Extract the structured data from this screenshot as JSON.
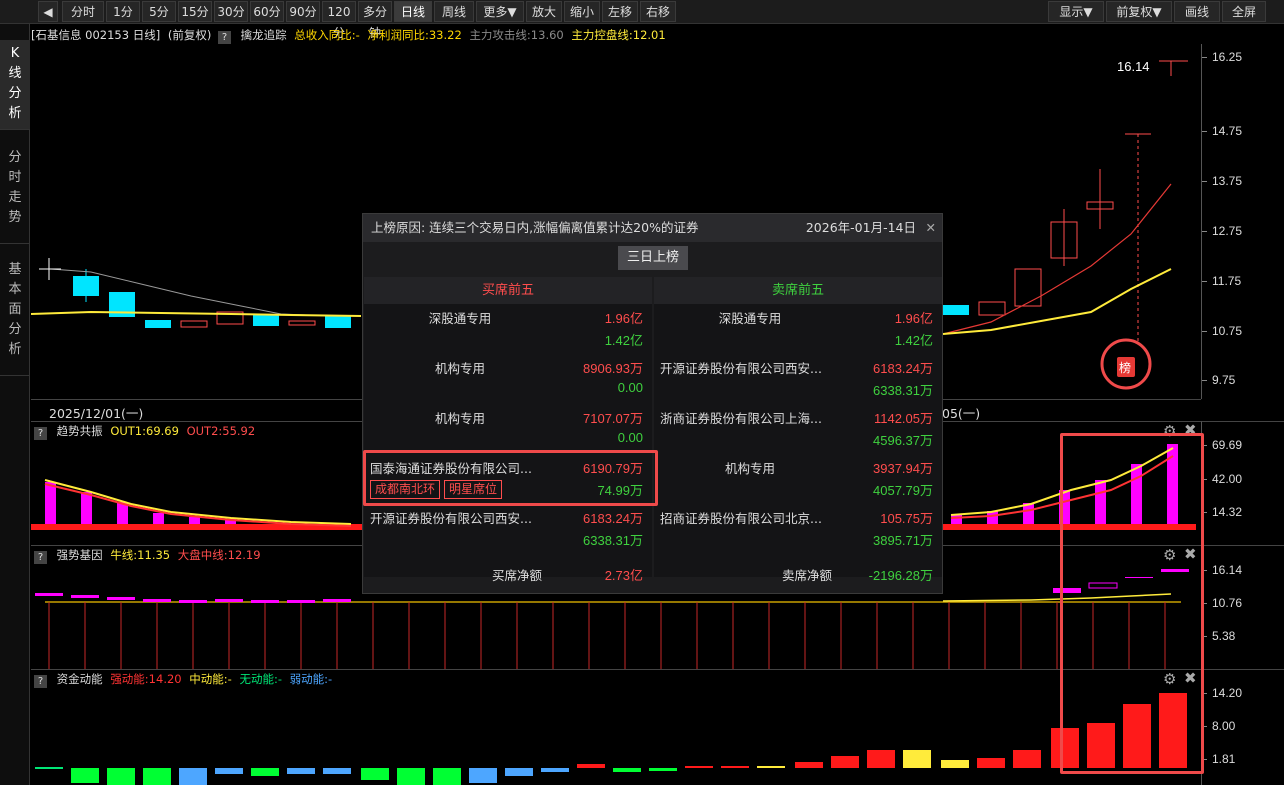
{
  "toolbar": {
    "items": [
      "分时",
      "1分",
      "5分",
      "15分",
      "30分",
      "60分",
      "90分",
      "120分",
      "多分钟",
      "日线",
      "周线",
      "更多▼",
      "放大",
      "缩小",
      "左移",
      "右移"
    ],
    "right": [
      "显示▼",
      "前复权▼",
      "画线",
      "全屏"
    ],
    "active": "日线"
  },
  "sidebar": {
    "tabs": [
      "K线分析",
      "分时走势",
      "基本面分析"
    ]
  },
  "info": {
    "stock": "[石基信息 002153 日线]",
    "adj": "(前复权)",
    "tool": "擒龙追踪",
    "revenue": "总收入同比:-",
    "profit": "净利润同比:33.22",
    "attack": "主力攻击线:13.60",
    "control": "主力控盘线:12.01"
  },
  "price_axis": {
    "ticks": [
      "16.25",
      "14.75",
      "13.75",
      "12.75",
      "11.75",
      "10.75",
      "9.75"
    ]
  },
  "price_chart": {
    "last_price": "16.14",
    "badge": "榜",
    "date_left": "2025/12/01(一)",
    "date_right": "05(一)"
  },
  "panel1": {
    "name": "趋势共振",
    "out1": "OUT1:69.69",
    "out2": "OUT2:55.92",
    "ticks": [
      "69.69",
      "42.00",
      "14.32"
    ]
  },
  "panel2": {
    "name": "强势基因",
    "bull": "牛线:11.35",
    "market": "大盘中线:12.19",
    "ticks": [
      "16.14",
      "10.76",
      "5.38"
    ]
  },
  "panel3": {
    "name": "资金动能",
    "strong": "强动能:14.20",
    "mid": "中动能:-",
    "none": "无动能:-",
    "weak": "弱动能:-",
    "ticks": [
      "14.20",
      "8.00",
      "1.81"
    ]
  },
  "popup": {
    "reason": "上榜原因: 连续三个交易日内,涨幅偏离值累计达20%的证券",
    "date": "2026年-01月-14日",
    "button": "三日上榜",
    "buy_title": "买席前五",
    "sell_title": "卖席前五",
    "buy_rows": [
      {
        "name": "深股通专用",
        "v1": "1.96亿",
        "v2": "1.42亿"
      },
      {
        "name": "机构专用",
        "v1": "8906.93万",
        "v2": "0.00"
      },
      {
        "name": "机构专用",
        "v1": "7107.07万",
        "v2": "0.00"
      },
      {
        "name": "国泰海通证券股份有限公司...",
        "v1": "6190.79万",
        "v2": "74.99万",
        "tag1": "成都南北环",
        "tag2": "明星席位"
      },
      {
        "name": "开源证券股份有限公司西安...",
        "v1": "6183.24万",
        "v2": "6338.31万"
      }
    ],
    "sell_rows": [
      {
        "name": "深股通专用",
        "v1": "1.96亿",
        "v2": "1.42亿"
      },
      {
        "name": "开源证券股份有限公司西安...",
        "v1": "6183.24万",
        "v2": "6338.31万"
      },
      {
        "name": "浙商证券股份有限公司上海...",
        "v1": "1142.05万",
        "v2": "4596.37万"
      },
      {
        "name": "机构专用",
        "v1": "3937.94万",
        "v2": "4057.79万"
      },
      {
        "name": "招商证券股份有限公司北京...",
        "v1": "105.75万",
        "v2": "3895.71万"
      }
    ],
    "buy_net_label": "买席净额",
    "buy_net": "2.73亿",
    "sell_net_label": "卖席净额",
    "sell_net": "-2196.28万"
  }
}
